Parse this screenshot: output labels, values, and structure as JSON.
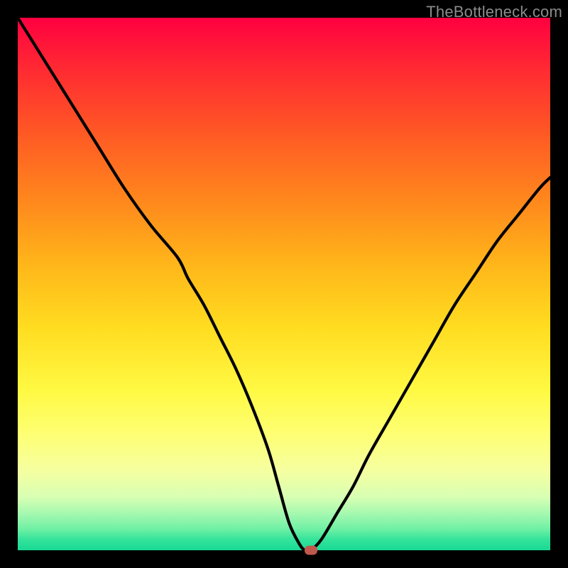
{
  "watermark": "TheBottleneck.com",
  "colors": {
    "frame": "#000000",
    "curve": "#000000",
    "marker": "#c1584d"
  },
  "chart_data": {
    "type": "line",
    "title": "",
    "xlabel": "",
    "ylabel": "",
    "xlim": [
      0,
      100
    ],
    "ylim": [
      0,
      100
    ],
    "grid": false,
    "x": [
      0,
      5,
      10,
      15,
      20,
      25,
      30,
      32,
      35,
      38,
      41,
      44,
      47,
      49,
      51,
      53,
      54,
      55,
      57,
      60,
      63,
      66,
      70,
      74,
      78,
      82,
      86,
      90,
      94,
      98,
      100
    ],
    "values": [
      100,
      92,
      84,
      76,
      68,
      61,
      55,
      51,
      46,
      40,
      34,
      27,
      19,
      12,
      5,
      1,
      0,
      0,
      2,
      7,
      12,
      18,
      25,
      32,
      39,
      46,
      52,
      58,
      63,
      68,
      70
    ],
    "marker": {
      "x": 55,
      "y": 0
    },
    "background_gradient": {
      "stops": [
        {
          "pos": 0.0,
          "color": "#ff0040"
        },
        {
          "pos": 0.35,
          "color": "#ff8a1c"
        },
        {
          "pos": 0.7,
          "color": "#fff943"
        },
        {
          "pos": 1.0,
          "color": "#17d994"
        }
      ]
    }
  }
}
